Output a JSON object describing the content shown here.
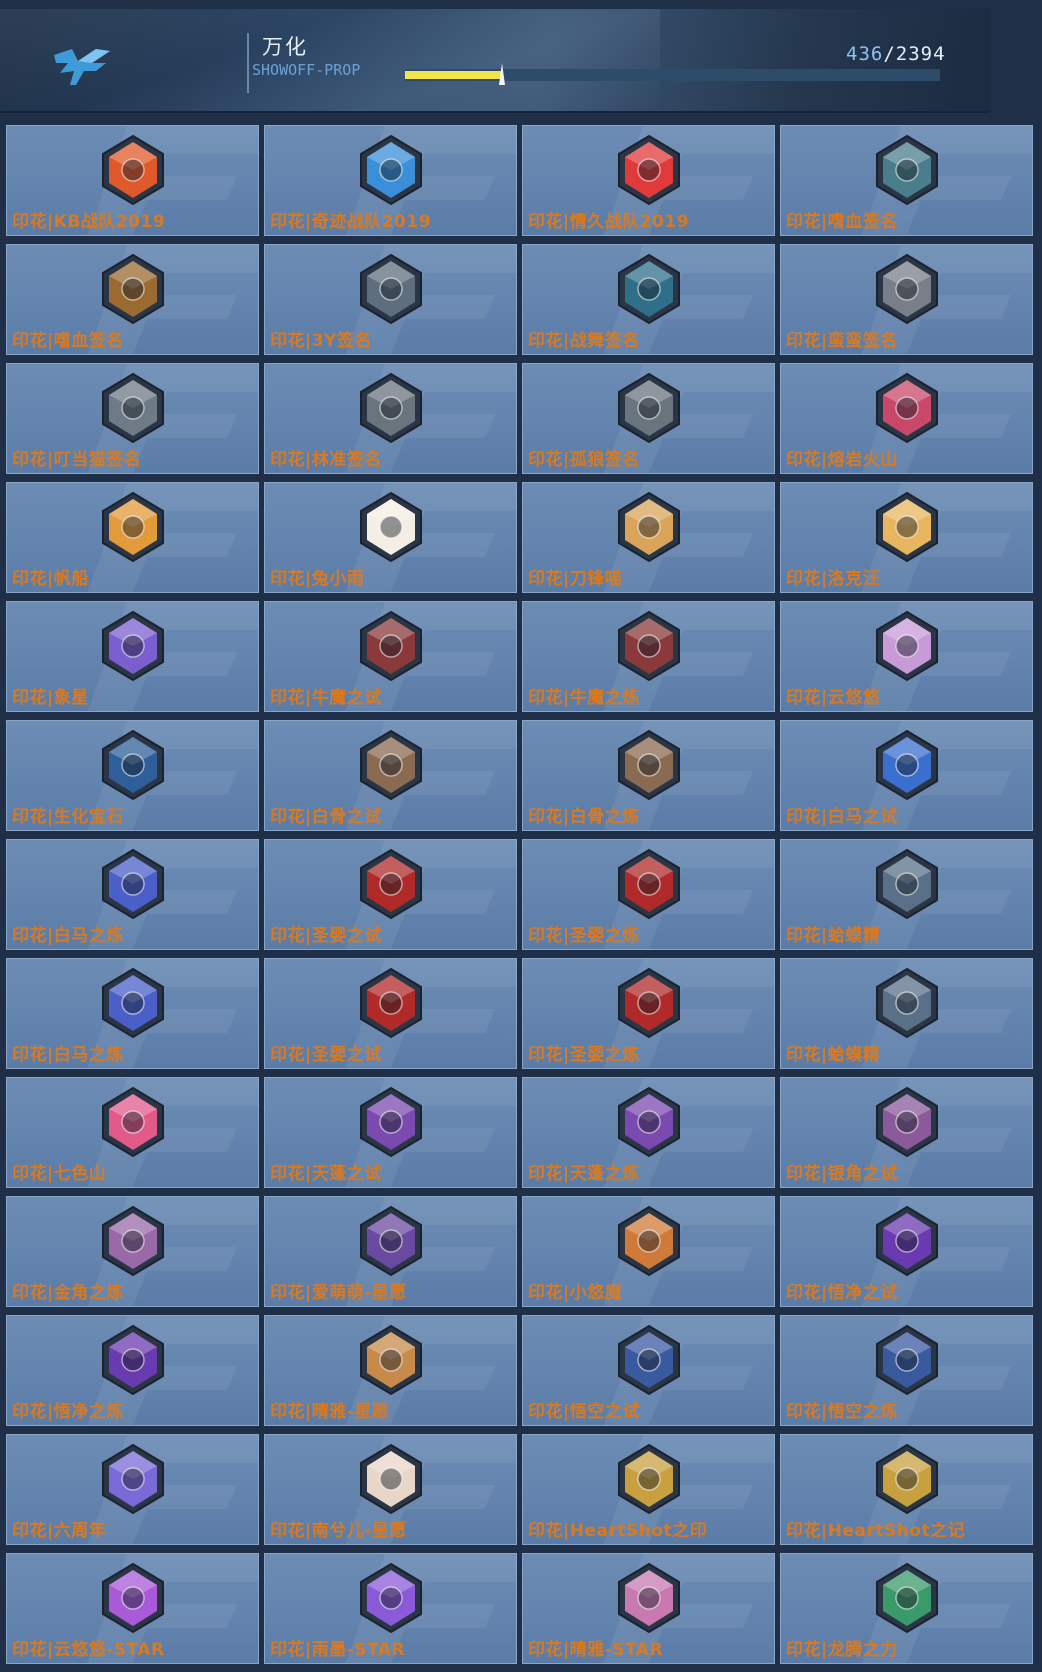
{
  "header": {
    "title": "万化",
    "subtitle": "SHOWOFF-PROP",
    "counter_current": "436",
    "counter_total": "/2394",
    "progress_fraction": 0.182
  },
  "colors": {
    "progress_fill": "#f2e54a",
    "label_text": "#d87a22",
    "counter_current": "#8fc1ef"
  },
  "items": [
    {
      "label": "印花|KB战队2019",
      "icon": "kb-team-badge-icon",
      "color": "#e0592a"
    },
    {
      "label": "印花|奇迹战队2019",
      "icon": "miracle-team-badge-icon",
      "color": "#3a8fd8"
    },
    {
      "label": "印花|情久战队2019",
      "icon": "qingjiu-team-badge-icon",
      "color": "#e03a3a"
    },
    {
      "label": "印花|嗜血签名",
      "icon": "bloody-signature-icon",
      "color": "#4a7e8c"
    },
    {
      "label": "印花|嗜血签名",
      "icon": "bloody-signature-gold-icon",
      "color": "#9a6a30"
    },
    {
      "label": "印花|3Y签名",
      "icon": "3y-signature-icon",
      "color": "#5e6e7e"
    },
    {
      "label": "印花|战舞签名",
      "icon": "zhanwu-signature-icon",
      "color": "#2f6f8a"
    },
    {
      "label": "印花|蛮蛮签名",
      "icon": "manman-signature-icon",
      "color": "#7a7e88"
    },
    {
      "label": "印花|叮当猫签名",
      "icon": "dingdangmao-signature-icon",
      "color": "#6e7a86"
    },
    {
      "label": "印花|林准签名",
      "icon": "linzhun-signature-icon",
      "color": "#6a747e"
    },
    {
      "label": "印花|孤狼签名",
      "icon": "gulang-signature-icon",
      "color": "#6a747e"
    },
    {
      "label": "印花|熔岩火山",
      "icon": "volcano-icon",
      "color": "#c9486a"
    },
    {
      "label": "印花|帆船",
      "icon": "sailboat-icon",
      "color": "#e39a3a"
    },
    {
      "label": "印花|兔小雨",
      "icon": "rabbit-icon",
      "color": "#f4efe4"
    },
    {
      "label": "印花|刀锋喵",
      "icon": "blade-cat-icon",
      "color": "#d9a45a"
    },
    {
      "label": "印花|洛克汪",
      "icon": "shiba-dog-icon",
      "color": "#e7b65e"
    },
    {
      "label": "印花|象星",
      "icon": "planet-icon",
      "color": "#7b5fd0"
    },
    {
      "label": "印花|牛魔之试",
      "icon": "s1-badge-icon",
      "color": "#8a3a3a"
    },
    {
      "label": "印花|牛魔之炼",
      "icon": "s1-badge-icon",
      "color": "#8a3a3a"
    },
    {
      "label": "印花|云悠悠",
      "icon": "yunyouyou-character-icon",
      "color": "#c89ad8"
    },
    {
      "label": "印花|生化宝石",
      "icon": "bio-gem-icon",
      "color": "#2f5f9a"
    },
    {
      "label": "印花|白骨之试",
      "icon": "s2-badge-icon",
      "color": "#8a6a50"
    },
    {
      "label": "印花|白骨之炼",
      "icon": "s2-badge-icon",
      "color": "#8a6a50"
    },
    {
      "label": "印花|白马之试",
      "icon": "s3-badge-icon",
      "color": "#3a6fcf"
    },
    {
      "label": "印花|白马之炼",
      "icon": "s3-badge-icon",
      "color": "#4a5fc8"
    },
    {
      "label": "印花|圣婴之试",
      "icon": "s4-badge-icon",
      "color": "#b02a2a"
    },
    {
      "label": "印花|圣婴之炼",
      "icon": "s4-badge-icon",
      "color": "#b02a2a"
    },
    {
      "label": "印花|蛤蟆精",
      "icon": "toad-icon",
      "color": "#5a7088"
    },
    {
      "label": "印花|白马之炼",
      "icon": "s3-badge-icon",
      "color": "#4a5fc8"
    },
    {
      "label": "印花|圣婴之试",
      "icon": "s4-badge-icon",
      "color": "#b02a2a"
    },
    {
      "label": "印花|圣婴之炼",
      "icon": "s4-badge-icon",
      "color": "#b02a2a"
    },
    {
      "label": "印花|蛤蟆精",
      "icon": "toad-icon",
      "color": "#5a7088"
    },
    {
      "label": "印花|七色山",
      "icon": "rainbow-mountain-icon",
      "color": "#e25a8a"
    },
    {
      "label": "印花|天蓬之试",
      "icon": "s5-badge-icon",
      "color": "#7a4ab0"
    },
    {
      "label": "印花|天蓬之炼",
      "icon": "s5-badge-icon",
      "color": "#7a4ab0"
    },
    {
      "label": "印花|银角之试",
      "icon": "s6-badge-icon",
      "color": "#8a5a9a"
    },
    {
      "label": "印花|金角之炼",
      "icon": "s6-badge-icon",
      "color": "#9a6aa8"
    },
    {
      "label": "印花|爱萌萌-星愿",
      "icon": "aimengmeng-character-icon",
      "color": "#6a4aa0"
    },
    {
      "label": "印花|小悠魔",
      "icon": "little-demon-icon",
      "color": "#d07a3a"
    },
    {
      "label": "印花|悟净之试",
      "icon": "s7-badge-icon",
      "color": "#6a3ab0"
    },
    {
      "label": "印花|悟净之炼",
      "icon": "s7-badge-icon",
      "color": "#6a3ab0"
    },
    {
      "label": "印花|晴雅-星愿",
      "icon": "qingya-character-icon",
      "color": "#c88a4a"
    },
    {
      "label": "印花|悟空之试",
      "icon": "s8-badge-icon",
      "color": "#3a5aa0"
    },
    {
      "label": "印花|悟空之炼",
      "icon": "s8-badge-icon",
      "color": "#3a5aa0"
    },
    {
      "label": "印花|六周年",
      "icon": "sixth-anniversary-icon",
      "color": "#7a6ad8"
    },
    {
      "label": "印花|南兮儿-星愿",
      "icon": "nanxier-character-icon",
      "color": "#e8d6c8"
    },
    {
      "label": "印花|HeartShot之印",
      "icon": "heartshot-badge-icon",
      "color": "#c8a040"
    },
    {
      "label": "印花|HeartShot之记",
      "icon": "heartshot-badge-alt-icon",
      "color": "#c8a040"
    },
    {
      "label": "印花|云悠悠-STAR",
      "icon": "yunyouyou-star-icon",
      "color": "#a85ad8"
    },
    {
      "label": "印花|雨墨-STAR",
      "icon": "yumo-star-icon",
      "color": "#8a5ad8"
    },
    {
      "label": "印花|晴雅-STAR",
      "icon": "qingya-star-icon",
      "color": "#c87ab0"
    },
    {
      "label": "印花|龙腾之力",
      "icon": "dragon-icon",
      "color": "#3a9a6a"
    }
  ]
}
